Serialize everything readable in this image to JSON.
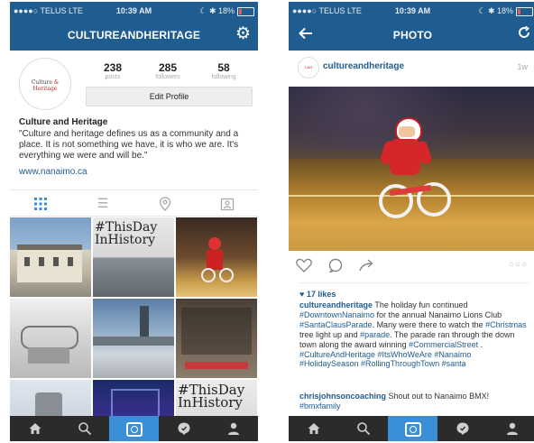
{
  "status_bar": {
    "carrier": "●●●●○ TELUS  LTE",
    "time": "10:39 AM",
    "battery": "☾ ✱ 18%"
  },
  "profile_screen": {
    "title": "CULTUREANDHERITAGE",
    "avatar_text_a": "Culture",
    "avatar_text_b": "& Heritage",
    "stats": [
      {
        "value": "238",
        "label": "posts"
      },
      {
        "value": "285",
        "label": "followers"
      },
      {
        "value": "58",
        "label": "following"
      }
    ],
    "edit_button": "Edit Profile",
    "bio_name": "Culture and Heritage",
    "bio_text": "\"Culture and heritage defines us as a community and a place. It is not something we have, it is who we are. It's everything we were and will be.\"",
    "bio_link": "www.nanaimo.ca",
    "grid_captions": {
      "tile_2": "#ThisDay InHistory",
      "tile_9": "#ThisDay InHistory"
    }
  },
  "photo_screen": {
    "title": "PHOTO",
    "username": "cultureandheritage",
    "time_ago": "1w",
    "more": "○○○",
    "likes": "♥ 17 likes",
    "caption_user": "cultureandheritage",
    "caption_text": " The holiday fun continued ",
    "caption_parts": {
      "t1": "#DowntownNanaimo",
      "t2": " for the annual Nanaimo Lions Club ",
      "t3": "#SantaClausParade",
      "t4": ".  Many were there to watch the ",
      "t5": "#Christmas",
      "t6": " tree light up and ",
      "t7": "#parade",
      "t8": ". The parade ran through the down town along the award winning ",
      "t9": "#CommercialStreet",
      "t10": " .  ",
      "t11": "#CultureAndHeritage #ItsWhoWeAre #Nanaimo #HolidaySeason #RollingThroughTown #santa"
    },
    "comment_user": "chrisjohnsoncoaching",
    "comment_text": " Shout out to Nanaimo BMX! ",
    "comment_tag": "#bmxfamily"
  },
  "tabbar_icons": [
    "home-icon",
    "search-icon",
    "camera-icon",
    "activity-icon",
    "profile-icon"
  ],
  "colors": {
    "nav": "#1f5c8f",
    "tabbar": "#2b2b2b",
    "active": "#3b8fd6",
    "link": "#1f5c8f"
  }
}
